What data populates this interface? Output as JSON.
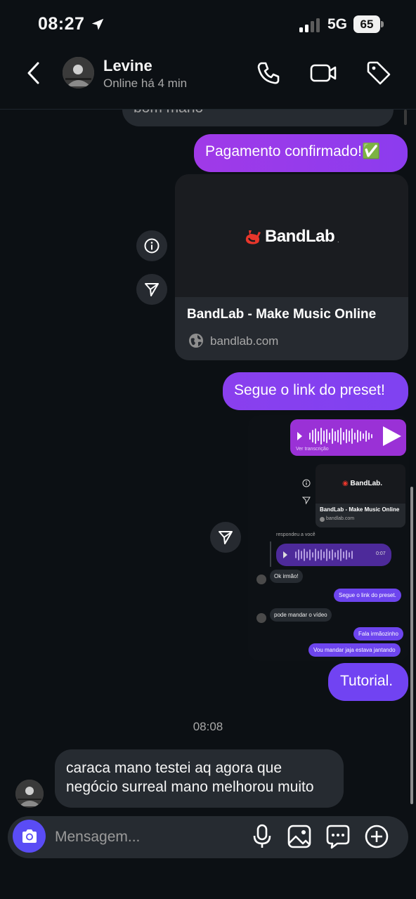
{
  "status_bar": {
    "time": "08:27",
    "network": "5G",
    "battery": "65"
  },
  "header": {
    "contact_name": "Levine",
    "contact_status": "Online há 4 min"
  },
  "messages": {
    "previous_partial": "bom mano",
    "payment": "Pagamento confirmado!✅",
    "link_card": {
      "brand": "BandLab",
      "title": "BandLab - Make Music Online",
      "domain": "bandlab.com"
    },
    "preset": "Segue o link do preset!",
    "tutorial": "Tutorial.",
    "time_separator": "08:08",
    "incoming": "caraca mano testei aq agora que negócio surreal mano melhorou muito"
  },
  "screenshot_preview": {
    "transcript_link": "Ver transcrição",
    "card_brand": "BandLab.",
    "card_title": "BandLab - Make Music Online",
    "card_domain": "bandlab.com",
    "reply_label": "respondeu a você",
    "audio_duration": "0:07",
    "msg_ok": "Ok irmão!",
    "msg_preset": "Segue o link do preset.",
    "msg_pode": "pode mandar o vídeo",
    "msg_fala": "Fala irmãozinho",
    "msg_vou": "Vou mandar jaja estava jantando"
  },
  "composer": {
    "placeholder": "Mensagem..."
  },
  "colors": {
    "background": "#0c1014",
    "outgoing_bubble": "#7f42f1",
    "incoming_bubble": "#262b31",
    "camera_button": "#5a4cf5",
    "bandlab_red": "#e8362b"
  },
  "icons": [
    "location-arrow-icon",
    "signal-icon",
    "battery-icon",
    "back-chevron-icon",
    "phone-icon",
    "video-camera-icon",
    "tag-icon",
    "info-icon",
    "share-icon",
    "globe-icon",
    "camera-icon",
    "microphone-icon",
    "image-icon",
    "sticker-icon",
    "add-circle-icon"
  ]
}
